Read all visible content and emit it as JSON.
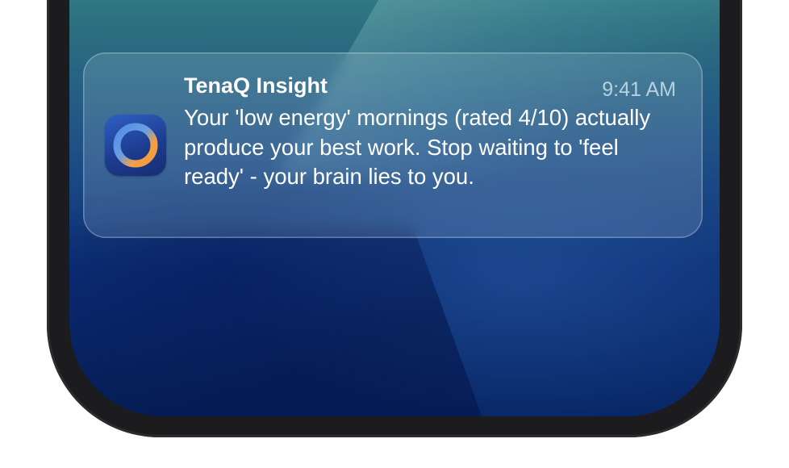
{
  "notification": {
    "app_name": "TenaQ Insight",
    "time": "9:41 AM",
    "message": "Your 'low energy' mornings (rated 4/10) actually produce your best work. Stop waiting to 'feel ready' - your brain lies to you.",
    "app_icon": "ring-logo-icon"
  },
  "colors": {
    "ring_blue": "#4f8fe8",
    "ring_orange": "#f39a3a",
    "icon_bg": "#1f3f92"
  }
}
